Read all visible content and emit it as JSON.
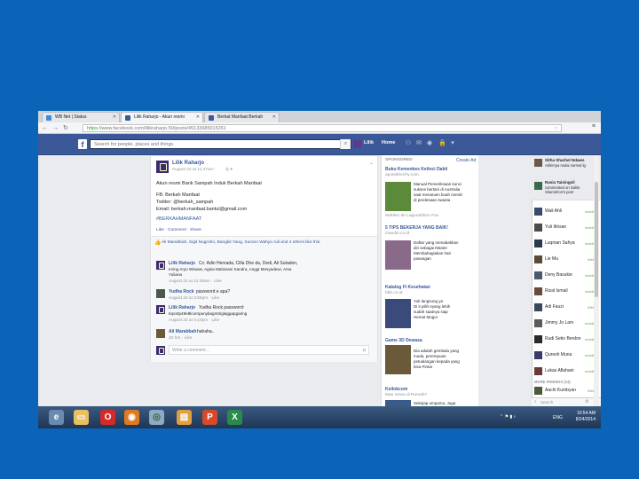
{
  "browser": {
    "tabs": [
      {
        "label": "WB Net | Status",
        "color": "#3e8ad6"
      },
      {
        "label": "Lilik Raharjo - Akun resmi",
        "color": "#3b5998"
      },
      {
        "label": "Berkat Manfaat Berkah",
        "color": "#3b5998"
      }
    ],
    "url_scheme": "https://",
    "url_rest": "www.facebook.com/lilikraharjo.50/posts/45133685015261"
  },
  "fb": {
    "logo": "f",
    "search_placeholder": "Search for people, places and things",
    "user": "Lilik",
    "home": "Home"
  },
  "post": {
    "author": "Lilik Raharjo",
    "meta": "August 22 at 11:47am · ",
    "lines": [
      "Akun resmi Bank Sampah Induk Berkah Manfaat",
      "FB: Berkah Manfaat",
      "Twitter: @berkah_sampah",
      "Email: berkah.manfaat.bantul@gmail.com",
      "#BERKAHMANFAAT"
    ],
    "actions": "Like · Comment · Share",
    "likes": "Ali Marabbah, Sigit Nugroho, Bangkit Yang, Surono Wahyo Adi and 4 others like this.",
    "comments": [
      {
        "name": "Lilik Raharjo",
        "text": "Cc: Adin Hemada, Cilla Dhe da, Dedi, Ali Sutadon,",
        "text2": "Irving Aryo Wiswar, Agnia Maharani Sandra, Anggi Mesyadewi, Arsa",
        "text3": "Yuliana",
        "meta": "August 22 at 11:48am · Like"
      },
      {
        "name": "Yudha Rock",
        "text": "password e apa?",
        "meta": "August 22 at 3:55pm · Like"
      },
      {
        "name": "Lilik Raharjo",
        "text": "Yudha Rock password:",
        "text2": "tepo0p49e8lcompanybagmtriglaggapgaring",
        "meta": "August 22 at 4:10pm · Like"
      },
      {
        "name": "Ali Marabbah",
        "text": "hahaha..",
        "meta": "20 hrs · Like"
      }
    ],
    "write_placeholder": "Write a comment..."
  },
  "right": {
    "header": "SPONSORED",
    "create_ad": "Create Ad",
    "ads": [
      {
        "title": "Buku Kemenkes Kelinci Dakti",
        "site": "apotekbenfry.com",
        "body": [
          "Manual Pemeriksaan kunci",
          "sukses bertani di Australia",
          "saat menanam buah merah",
          "di perdesaan swasta"
        ],
        "foot": "Weblen de Lagunahbon Fax",
        "color": "#5a8a3a"
      },
      {
        "title": "5 TIPS BEKERJA YANG BAIK!",
        "site": "mandiri.co.id",
        "body": [
          "Daftar yang menabahkan",
          "diri sebagai Master",
          "Membahagiakan hati",
          "pasangan"
        ],
        "foot": "",
        "color": "#8a6a8a"
      },
      {
        "title": "Katalog Fi Kesehatan",
        "site": "bbb.co.id",
        "body": [
          "Yuk langsung ya",
          "Di it pilih eyang lebih",
          "sudah saatnya siap",
          "Hemat Mugor"
        ],
        "foot": "",
        "color": "#3a4a7a"
      },
      {
        "title": "Game 3D Dewasa",
        "site": "",
        "body": [
          "Dia adalah gembala yang",
          "muda, perempuan",
          "petualangan kepada yang",
          "bisa Pintar"
        ],
        "foot": "",
        "color": "#6a5a3a"
      },
      {
        "title": "Keilokcom",
        "site": "Mau Sewa di Rumah?",
        "body": [
          "Sekejap umpama, Juga",
          "Komplit"
        ],
        "foot": "",
        "color": "#3a5a8a"
      }
    ]
  },
  "chat": {
    "news": [
      {
        "name": "Sitha Sharhel Ndaws",
        "text": "Akhirnya mulai normal lg",
        "color": "#6a5a4a"
      },
      {
        "name": "Rasia Taisingsil",
        "text": "commented on Salim Situmehon's post",
        "color": "#3a6a4a"
      }
    ],
    "contacts": [
      {
        "name": "Wali Ahli",
        "status": "mobile",
        "color": "#3a4a6a"
      },
      {
        "name": "Yuli Ikhsan",
        "status": "mobile",
        "color": "#4a4a4a"
      },
      {
        "name": "Luqman Sahya",
        "status": "mobile",
        "color": "#2a3a4a"
      },
      {
        "name": "Lie Mu",
        "status": "Web",
        "color": "#5a4a3a"
      },
      {
        "name": "Deny Basukie",
        "status": "mobile",
        "color": "#4a5a6a"
      },
      {
        "name": "Rizal Ismail",
        "status": "mobile",
        "color": "#6a4a3a"
      },
      {
        "name": "Adi Fauzi",
        "status": "Web",
        "color": "#3a4a5a"
      },
      {
        "name": "Jimmy Jo Lam",
        "status": "mobile",
        "color": "#5a5a5a"
      },
      {
        "name": "Rudi Setio Berdon",
        "status": "mobile",
        "color": "#2a2a2a"
      },
      {
        "name": "Quresh Muna",
        "status": "mobile",
        "color": "#3a3a6a"
      },
      {
        "name": "Lukas Aflahani",
        "status": "mobile",
        "color": "#6a3a3a"
      }
    ],
    "more_label": "MORE FRIENDS (24)",
    "more": [
      {
        "name": "Aachi Kumbyan",
        "status": "Web",
        "color": "#4a5a3a"
      }
    ],
    "search": "Search"
  },
  "taskbar": {
    "icons": [
      {
        "name": "ie",
        "glyph": "e",
        "color": "#3a8ad6"
      },
      {
        "name": "explorer",
        "glyph": "▭",
        "color": "#e8c060"
      },
      {
        "name": "opera",
        "glyph": "O",
        "color": "#d42a2a"
      },
      {
        "name": "firefox",
        "glyph": "◉",
        "color": "#e07a20"
      },
      {
        "name": "chrome",
        "glyph": "◎",
        "color": "#4ab04a"
      },
      {
        "name": "paint",
        "glyph": "▤",
        "color": "#e0a040"
      },
      {
        "name": "powerpoint",
        "glyph": "P",
        "color": "#d44a2a"
      },
      {
        "name": "excel",
        "glyph": "X",
        "color": "#2a8a4a"
      }
    ],
    "lang": "ENG",
    "time": "10:54 AM",
    "date": "8/24/2014"
  }
}
